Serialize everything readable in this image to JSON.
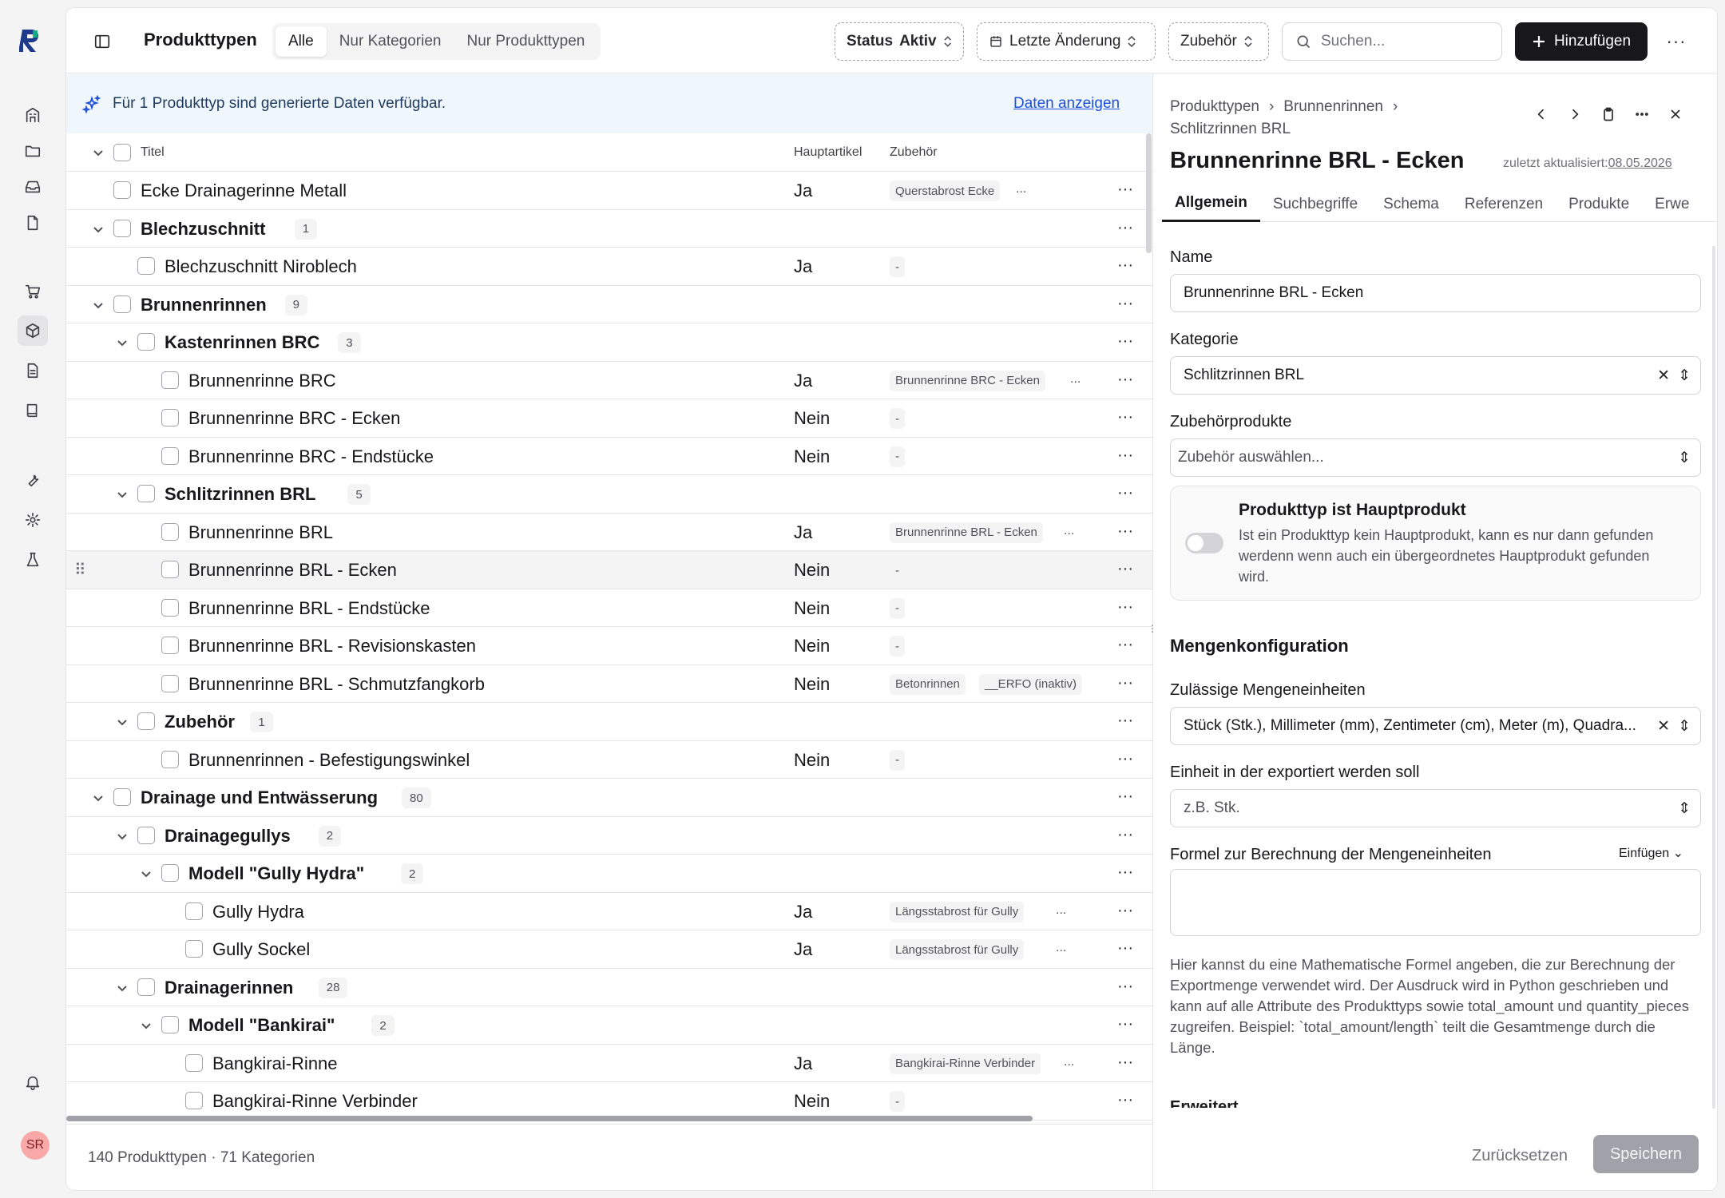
{
  "sidebar": {
    "logo": "R",
    "icons": [
      "building-icon",
      "folder-icon",
      "inbox-icon",
      "file-icon",
      "cart-icon",
      "box-icon",
      "document-icon",
      "book-icon",
      "wrench-icon",
      "gear-icon",
      "flask-icon",
      "bell-icon"
    ],
    "user_initials": "SR"
  },
  "header": {
    "title": "Produkttypen",
    "segments": [
      "Alle",
      "Nur Kategorien",
      "Nur Produkttypen"
    ],
    "filter_status_label": "Status",
    "filter_status_value": "Aktiv",
    "filter_changed": "Letzte Änderung",
    "filter_accessory": "Zubehör",
    "search_placeholder": "Suchen...",
    "add_label": "Hinzufügen",
    "more": "···"
  },
  "banner": {
    "text": "Für 1 Produkttyp sind generierte Daten verfügbar.",
    "link": "Daten anzeigen"
  },
  "table": {
    "columns": {
      "title": "Titel",
      "main": "Hauptartikel",
      "accessory": "Zubehör"
    },
    "rows": [
      {
        "title": "Ecke Drainagerinne Metall",
        "main": "Ja",
        "chip": "Querstabrost Ecke",
        "more": "..."
      },
      {
        "title": "Blechzuschnitt",
        "count": "1"
      },
      {
        "title": "Blechzuschnitt Niroblech",
        "main": "Ja",
        "chip": "-"
      },
      {
        "title": "Brunnenrinnen",
        "count": "9"
      },
      {
        "title": "Kastenrinnen BRC",
        "count": "3"
      },
      {
        "title": "Brunnenrinne BRC",
        "main": "Ja",
        "chip": "Brunnenrinne BRC - Ecken",
        "more": "..."
      },
      {
        "title": "Brunnenrinne BRC - Ecken",
        "main": "Nein",
        "chip": "-"
      },
      {
        "title": "Brunnenrinne BRC - Endstücke",
        "main": "Nein",
        "chip": "-"
      },
      {
        "title": "Schlitzrinnen BRL",
        "count": "5"
      },
      {
        "title": "Brunnenrinne BRL",
        "main": "Ja",
        "chip": "Brunnenrinne BRL - Ecken",
        "more": "..."
      },
      {
        "title": "Brunnenrinne BRL - Ecken",
        "main": "Nein",
        "chip": "-"
      },
      {
        "title": "Brunnenrinne BRL - Endstücke",
        "main": "Nein",
        "chip": "-"
      },
      {
        "title": "Brunnenrinne BRL - Revisionskasten",
        "main": "Nein",
        "chip": "-"
      },
      {
        "title": "Brunnenrinne BRL - Schmutzfangkorb",
        "main": "Nein",
        "chip": "Betonrinnen",
        "chip2": "__ERFO  (inaktiv)"
      },
      {
        "title": "Zubehör",
        "count": "1"
      },
      {
        "title": "Brunnenrinnen - Befestigungswinkel",
        "main": "Nein",
        "chip": "-"
      },
      {
        "title": "Drainage und Entwässerung",
        "count": "80"
      },
      {
        "title": "Drainagegullys",
        "count": "2"
      },
      {
        "title": "Modell \"Gully Hydra\"",
        "count": "2"
      },
      {
        "title": "Gully Hydra",
        "main": "Ja",
        "chip": "Längsstabrost für Gully",
        "more": "..."
      },
      {
        "title": "Gully Sockel",
        "main": "Ja",
        "chip": "Längsstabrost für Gully",
        "more": "..."
      },
      {
        "title": "Drainagerinnen",
        "count": "28"
      },
      {
        "title": "Modell \"Bankirai\"",
        "count": "2"
      },
      {
        "title": "Bangkirai-Rinne",
        "main": "Ja",
        "chip": "Bangkirai-Rinne Verbinder",
        "more": "..."
      },
      {
        "title": "Bangkirai-Rinne Verbinder",
        "main": "Nein",
        "chip": "-"
      }
    ],
    "row_more": "···",
    "footer": "140 Produkttypen  ·  71 Kategorien"
  },
  "detail": {
    "breadcrumb": [
      "Produkttypen",
      "Brunnenrinnen",
      "Schlitzrinnen BRL"
    ],
    "title": "Brunnenrinne BRL - Ecken",
    "updated_label": "zuletzt aktualisiert:",
    "updated_date": "08.05.2026",
    "tabs": [
      "Allgemein",
      "Suchbegriffe",
      "Schema",
      "Referenzen",
      "Produkte",
      "Erwe"
    ],
    "name_label": "Name",
    "name_value": "Brunnenrinne BRL - Ecken",
    "category_label": "Kategorie",
    "category_value": "Schlitzrinnen BRL",
    "accessories_label": "Zubehörprodukte",
    "accessories_placeholder": "Zubehör auswählen...",
    "main_toggle_title": "Produkttyp ist Hauptprodukt",
    "main_toggle_desc": "Ist ein Produkttyp kein Hauptprodukt, kann es nur dann gefunden werdenn wenn auch ein übergeordnetes Hauptprodukt gefunden wird.",
    "quantity_section": "Mengenkonfiguration",
    "units_label": "Zulässige Mengeneinheiten",
    "units_value": "Stück (Stk.), Millimeter (mm), Zentimeter (cm), Meter (m), Quadra...",
    "export_unit_label": "Einheit in der exportiert werden soll",
    "export_unit_placeholder": "z.B. Stk.",
    "formula_label": "Formel zur Berechnung der Mengeneinheiten",
    "insert_label": "Einfügen",
    "formula_help": "Hier kannst du eine Mathematische Formel angeben, die zur Berechnung der Exportmenge verwendet wird. Der Ausdruck wird in Python geschrieben und kann auf alle Attribute des Produkttyps sowie total_amount und quantity_pieces zugreifen. Beispiel: `total_amount/length` teilt die Gesamtmenge durch die Länge.",
    "extended_section": "Erweitert",
    "reset_label": "Zurücksetzen",
    "save_label": "Speichern"
  }
}
